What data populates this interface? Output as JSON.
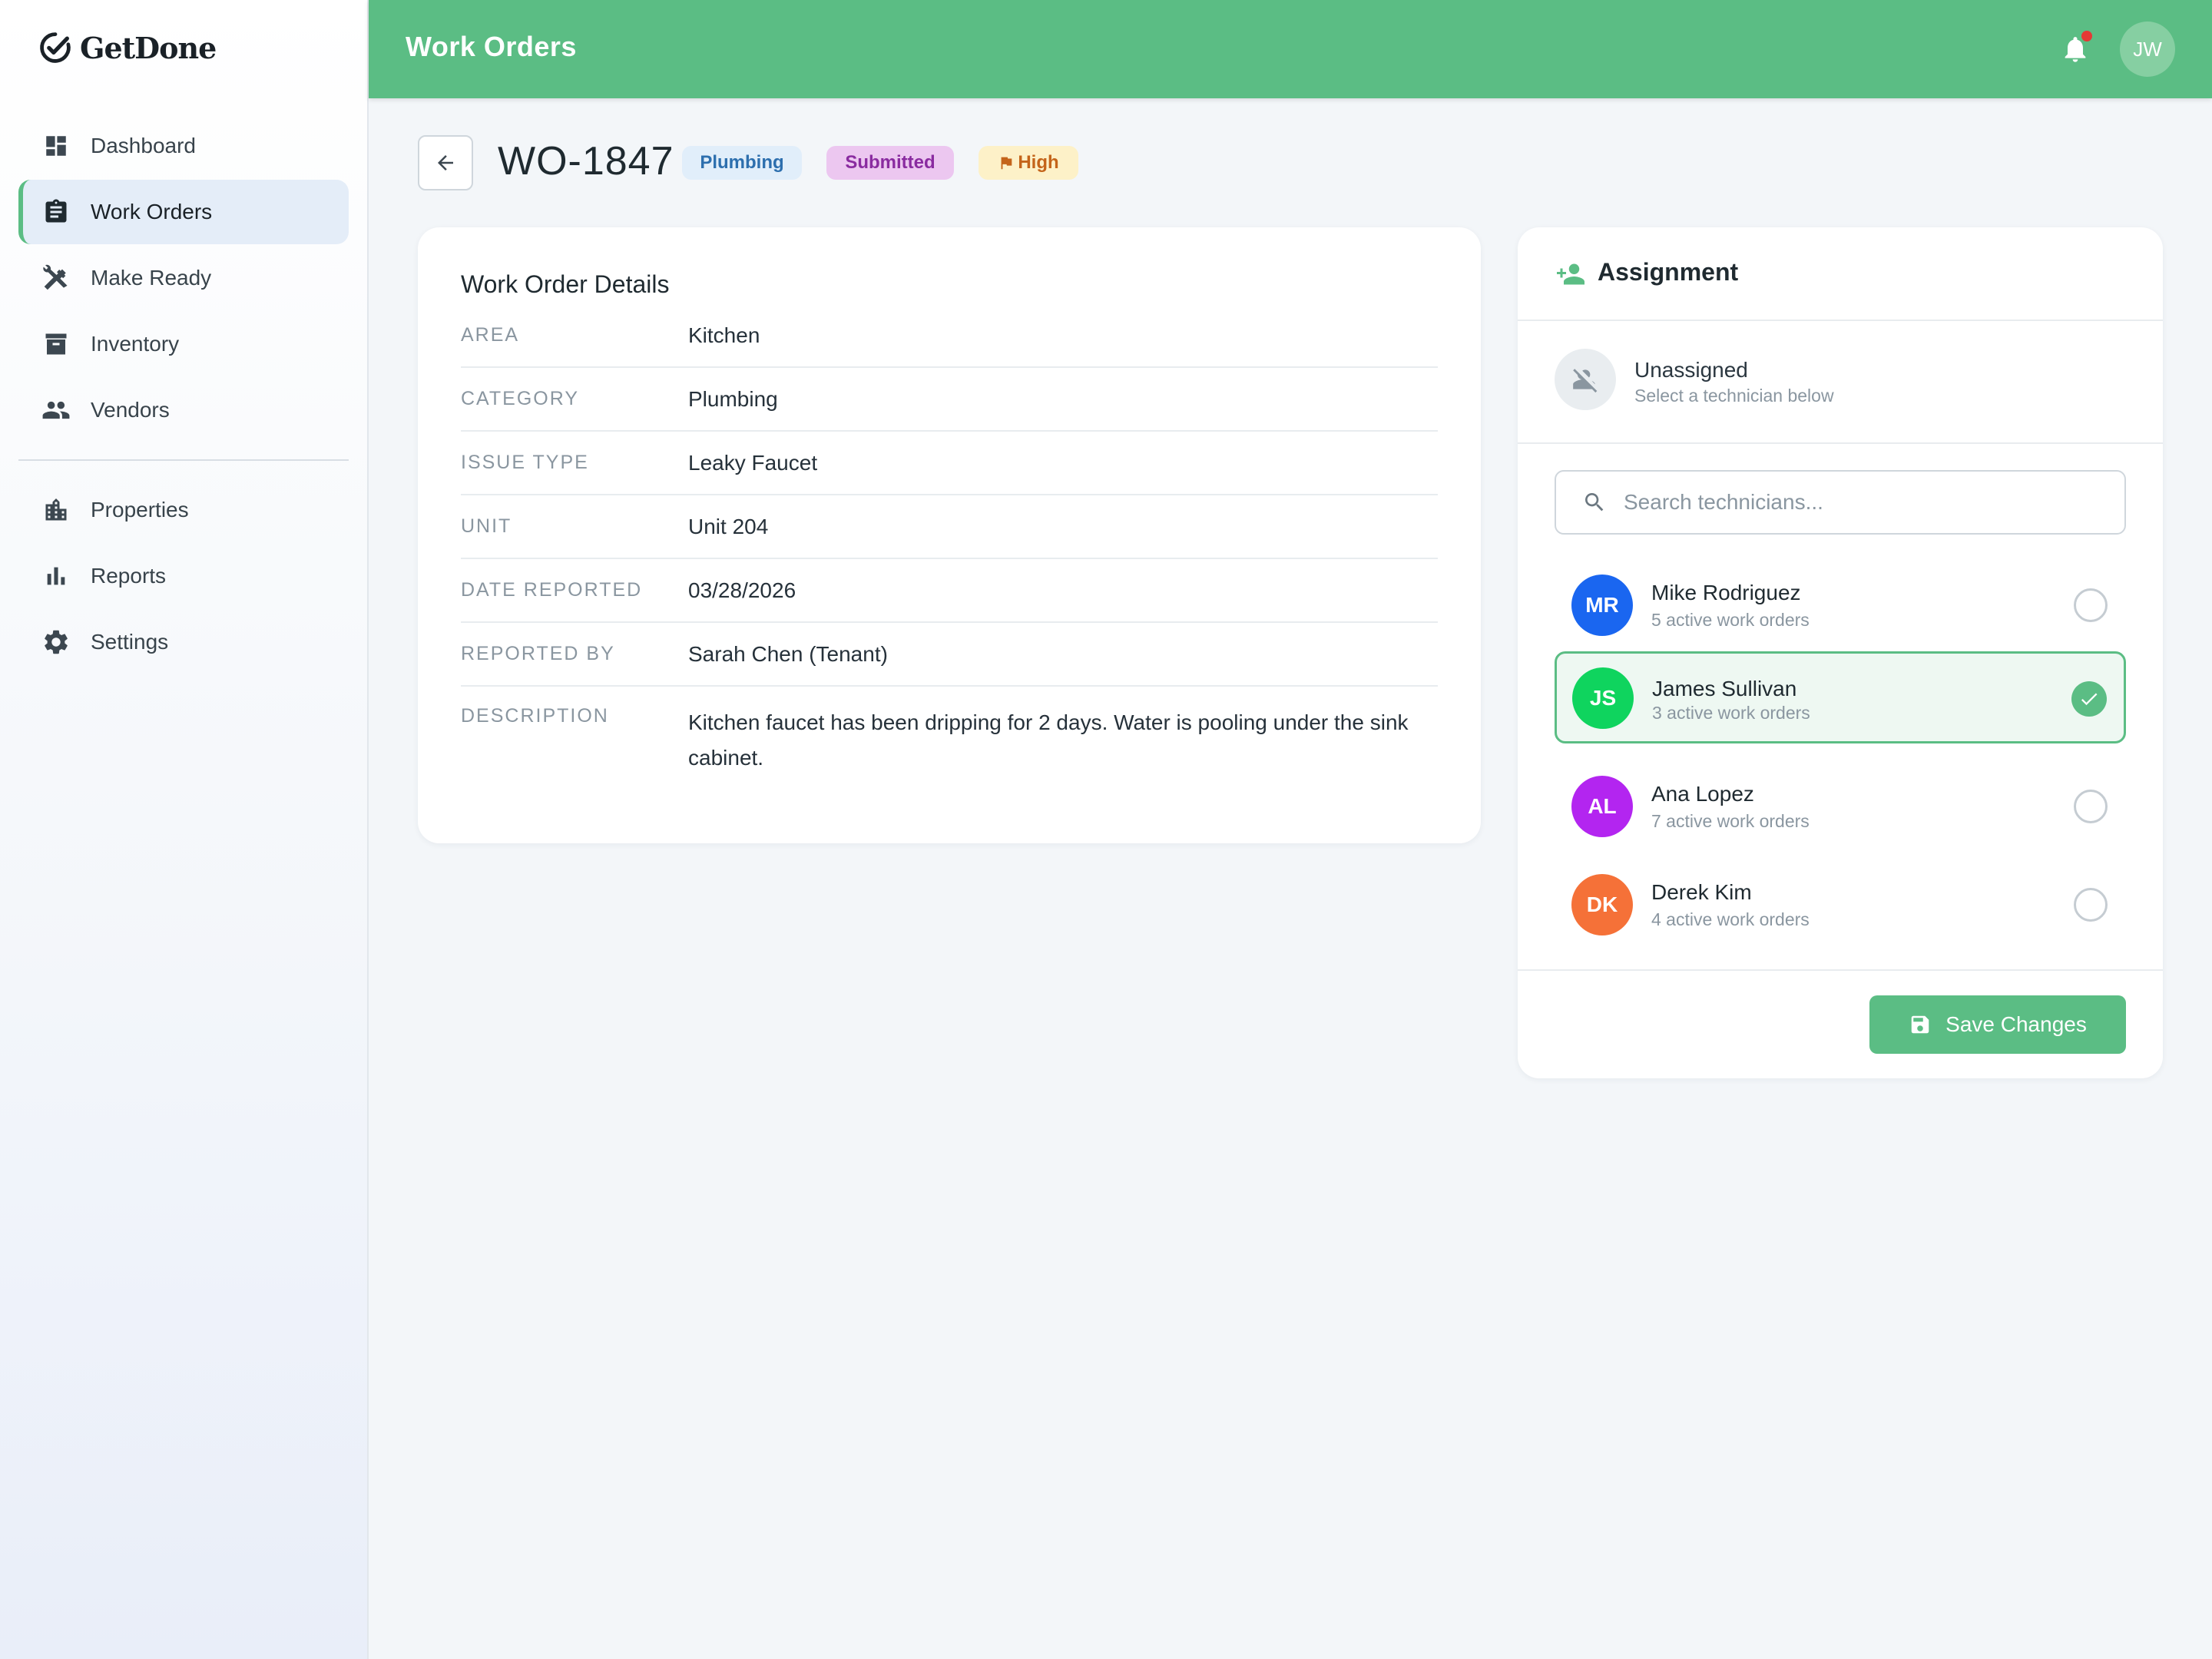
{
  "app": {
    "name": "GetDone"
  },
  "sidebar": {
    "items": [
      {
        "label": "Dashboard",
        "icon": "dashboard-icon"
      },
      {
        "label": "Work Orders",
        "icon": "clipboard-icon",
        "active": true
      },
      {
        "label": "Make Ready",
        "icon": "tools-icon"
      },
      {
        "label": "Inventory",
        "icon": "archive-icon"
      },
      {
        "label": "Vendors",
        "icon": "people-icon"
      }
    ],
    "secondary": [
      {
        "label": "Properties",
        "icon": "building-icon"
      },
      {
        "label": "Reports",
        "icon": "bar-chart-icon"
      },
      {
        "label": "Settings",
        "icon": "gear-icon"
      }
    ]
  },
  "topbar": {
    "title": "Work Orders",
    "user_initials": "JW",
    "has_notification": true
  },
  "work_order": {
    "id": "WO-1847",
    "badges": {
      "category": "Plumbing",
      "status": "Submitted",
      "priority": "High"
    }
  },
  "details": {
    "title": "Work Order Details",
    "rows": [
      {
        "key": "AREA",
        "value": "Kitchen"
      },
      {
        "key": "CATEGORY",
        "value": "Plumbing"
      },
      {
        "key": "ISSUE TYPE",
        "value": "Leaky Faucet"
      },
      {
        "key": "UNIT",
        "value": "Unit 204"
      },
      {
        "key": "DATE REPORTED",
        "value": "03/28/2026"
      },
      {
        "key": "REPORTED BY",
        "value": "Sarah Chen (Tenant)"
      },
      {
        "key": "DESCRIPTION",
        "value": "Kitchen faucet has been dripping for 2 days. Water is pooling under the sink cabinet."
      }
    ]
  },
  "assignment": {
    "title": "Assignment",
    "current": {
      "label": "Unassigned",
      "hint": "Select a technician below"
    },
    "search": {
      "placeholder": "Search technicians...",
      "value": ""
    },
    "technicians": [
      {
        "initials": "MR",
        "name": "Mike Rodriguez",
        "sub": "5 active work orders",
        "color": "#1a66f0",
        "selected": false
      },
      {
        "initials": "JS",
        "name": "James Sullivan",
        "sub": "3 active work orders",
        "color": "#0fd45e",
        "selected": true
      },
      {
        "initials": "AL",
        "name": "Ana Lopez",
        "sub": "7 active work orders",
        "color": "#b325f0",
        "selected": false
      },
      {
        "initials": "DK",
        "name": "Derek Kim",
        "sub": "4 active work orders",
        "color": "#f57138",
        "selected": false
      }
    ],
    "save_label": "Save Changes"
  },
  "colors": {
    "accent": "#5bbd84",
    "plumbing_badge": "#e1eefa",
    "submitted_badge": "#ecc7f0",
    "high_badge": "#fdf1c8"
  }
}
